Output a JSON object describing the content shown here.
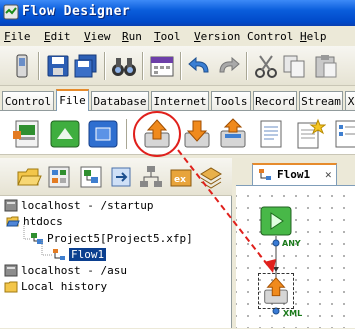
{
  "window": {
    "title": "Flow Designer"
  },
  "menu": [
    "File",
    "Edit",
    "View",
    "Run",
    "Tool",
    "Version Control",
    "Help"
  ],
  "toolbar": {
    "icons": [
      "phone-icon",
      "save-icon",
      "save-all-icon",
      "binoculars-icon",
      "calendar-icon",
      "undo-icon",
      "redo-icon",
      "cut-icon",
      "copy-icon",
      "paste-icon"
    ]
  },
  "tabs": [
    "Control",
    "File",
    "Database",
    "Internet",
    "Tools",
    "Record",
    "Stream",
    "X"
  ],
  "active_tab": "File",
  "palette": {
    "icons": [
      "file-grid-icon",
      "run-green-icon",
      "stop-blue-icon",
      "upload-file-icon",
      "download-file-icon",
      "transfer-file-icon",
      "document-icon",
      "new-document-icon",
      "document-list-icon"
    ],
    "highlighted": "upload-file-icon"
  },
  "tree": {
    "nodes": [
      {
        "label": "localhost - /startup"
      },
      {
        "label": "htdocs"
      },
      {
        "label": "Project5[Project5.xfp]"
      },
      {
        "label": "Flow1"
      },
      {
        "label": "localhost - /asu"
      },
      {
        "label": "Local history"
      }
    ],
    "selected": "Flow1"
  },
  "editor": {
    "tab_label": "Flow1",
    "close_glyph": "✕",
    "port_any": "ANY",
    "port_xml": "XML"
  },
  "colors": {
    "accent": "#e68b2c",
    "annotation": "#e0201c",
    "selection": "#0b3f8f"
  }
}
